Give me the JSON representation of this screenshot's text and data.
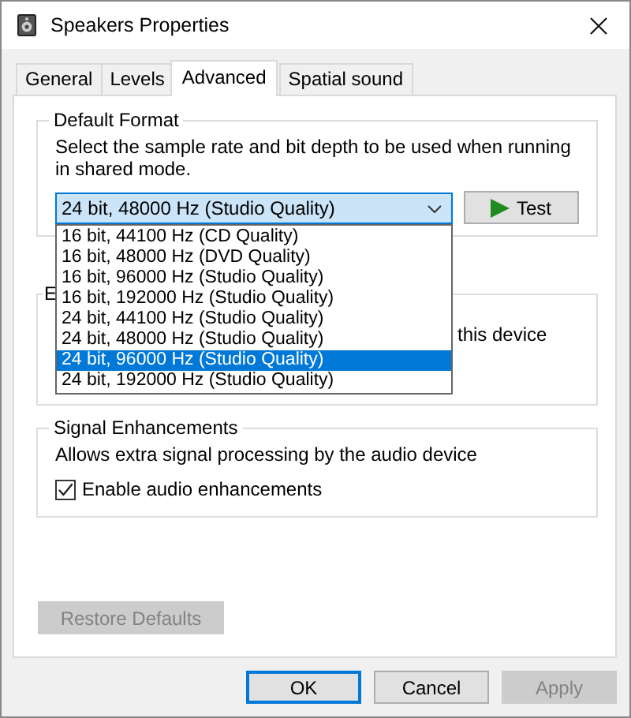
{
  "window": {
    "title": "Speakers Properties"
  },
  "tabs": [
    {
      "label": "General",
      "selected": false
    },
    {
      "label": "Levels",
      "selected": false
    },
    {
      "label": "Advanced",
      "selected": true
    },
    {
      "label": "Spatial sound",
      "selected": false
    }
  ],
  "default_format": {
    "title": "Default Format",
    "description": "Select the sample rate and bit depth to be used when running in shared mode.",
    "combo": {
      "value": "24 bit, 48000 Hz (Studio Quality)",
      "expanded": true
    },
    "test_button": {
      "label": "Test"
    },
    "options": [
      {
        "label": "16 bit, 44100 Hz (CD Quality)",
        "selected": false
      },
      {
        "label": "16 bit, 48000 Hz (DVD Quality)",
        "selected": false
      },
      {
        "label": "16 bit, 96000 Hz (Studio Quality)",
        "selected": false
      },
      {
        "label": "16 bit, 192000 Hz (Studio Quality)",
        "selected": false
      },
      {
        "label": "24 bit, 44100 Hz (Studio Quality)",
        "selected": false
      },
      {
        "label": "24 bit, 48000 Hz (Studio Quality)",
        "selected": false
      },
      {
        "label": "24 bit, 96000 Hz (Studio Quality)",
        "selected": true
      },
      {
        "label": "24 bit, 192000 Hz (Studio Quality)",
        "selected": false
      }
    ]
  },
  "exclusive_mode": {
    "title": "E",
    "text": "this device"
  },
  "signal_enhancements": {
    "title": "Signal Enhancements",
    "description": "Allows extra signal processing by the audio device",
    "checkbox": {
      "label": "Enable audio enhancements",
      "checked": true
    }
  },
  "restore_button": {
    "label": "Restore Defaults",
    "disabled": true
  },
  "buttons": [
    {
      "label": "OK",
      "default": true,
      "disabled": false
    },
    {
      "label": "Cancel",
      "default": false,
      "disabled": false
    },
    {
      "label": "Apply",
      "default": false,
      "disabled": true
    }
  ]
}
